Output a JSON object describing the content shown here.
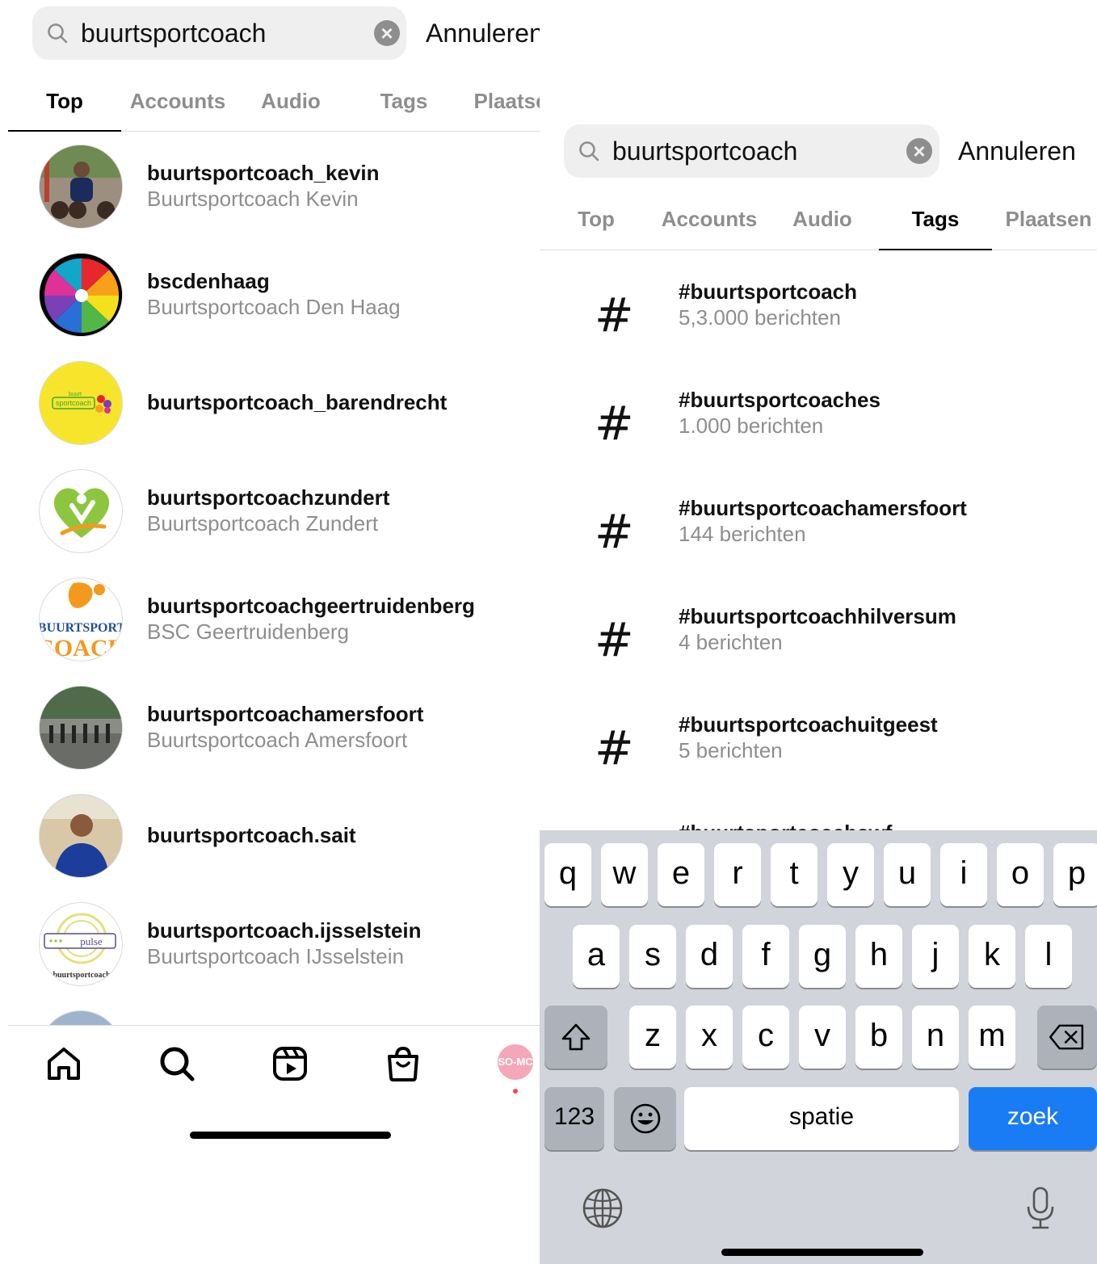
{
  "left": {
    "search": {
      "query": "buurtsportcoach",
      "cancel_label": "Annuleren"
    },
    "tabs": [
      {
        "label": "Top",
        "active": true
      },
      {
        "label": "Accounts",
        "active": false
      },
      {
        "label": "Audio",
        "active": false
      },
      {
        "label": "Tags",
        "active": false
      },
      {
        "label": "Plaatsen",
        "active": false
      }
    ],
    "accounts": [
      {
        "username": "buurtsportcoach_kevin",
        "fullname": "Buurtsportcoach Kevin"
      },
      {
        "username": "bscdenhaag",
        "fullname": "Buurtsportcoach Den Haag"
      },
      {
        "username": "buurtsportcoach_barendrecht",
        "fullname": ""
      },
      {
        "username": "buurtsportcoachzundert",
        "fullname": "Buurtsportcoach Zundert"
      },
      {
        "username": "buurtsportcoachgeertruidenberg",
        "fullname": "BSC Geertruidenberg"
      },
      {
        "username": "buurtsportcoachamersfoort",
        "fullname": "Buurtsportcoach Amersfoort"
      },
      {
        "username": "buurtsportcoach.sait",
        "fullname": ""
      },
      {
        "username": "buurtsportcoach.ijsselstein",
        "fullname": "Buurtsportcoach IJsselstein"
      }
    ],
    "avatar_texts": {
      "barendrecht": "sportcoach",
      "barendrecht_top": "buurt",
      "geertruidenberg_1": "BUURTSPORT",
      "geertruidenberg_2": "COACH",
      "ijsselstein_pulse": "pulse",
      "ijsselstein_bottom": "buurtsportcoach"
    },
    "bottom_nav": {
      "items": [
        "home-icon",
        "search-icon",
        "reels-icon",
        "shop-icon",
        "profile-avatar"
      ],
      "profile_text": "SO-MC",
      "accent": "#ed4956"
    }
  },
  "right": {
    "search": {
      "query": "buurtsportcoach",
      "cancel_label": "Annuleren"
    },
    "tabs": [
      {
        "label": "Top",
        "active": false
      },
      {
        "label": "Accounts",
        "active": false
      },
      {
        "label": "Audio",
        "active": false
      },
      {
        "label": "Tags",
        "active": true
      },
      {
        "label": "Plaatsen",
        "active": false
      }
    ],
    "tags": [
      {
        "symbol": "#",
        "name": "#buurtsportcoach",
        "count": "5,3.000 berichten"
      },
      {
        "symbol": "#",
        "name": "#buurtsportcoaches",
        "count": "1.000 berichten"
      },
      {
        "symbol": "#",
        "name": "#buurtsportcoachamersfoort",
        "count": "144 berichten"
      },
      {
        "symbol": "#",
        "name": "#buurtsportcoachhilversum",
        "count": "4 berichten"
      },
      {
        "symbol": "#",
        "name": "#buurtsportcoachuitgeest",
        "count": "5 berichten"
      },
      {
        "symbol": "#",
        "name": "#buurtsportcoachswf",
        "count": ""
      }
    ],
    "keyboard": {
      "row1": [
        "q",
        "w",
        "e",
        "r",
        "t",
        "y",
        "u",
        "i",
        "o",
        "p"
      ],
      "row2": [
        "a",
        "s",
        "d",
        "f",
        "g",
        "h",
        "j",
        "k",
        "l"
      ],
      "row3": [
        "z",
        "x",
        "c",
        "v",
        "b",
        "n",
        "m"
      ],
      "numbers_label": "123",
      "space_label": "spatie",
      "search_label": "zoek",
      "search_key_color": "#1a7cf5"
    }
  }
}
